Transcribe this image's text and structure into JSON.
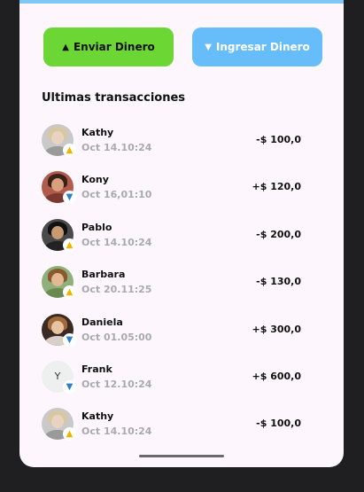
{
  "actions": {
    "send": {
      "label": "Enviar Dinero",
      "glyph": "▲"
    },
    "receive": {
      "label": "Ingresar Dinero",
      "glyph": "▼"
    }
  },
  "section_title": "Ultimas transacciones",
  "transactions": [
    {
      "name": "Kathy",
      "date": "Oct 14.10:24",
      "amount": "-$ 100,0",
      "direction": "up",
      "badge": "▲"
    },
    {
      "name": "Kony",
      "date": "Oct 16,01:10",
      "amount": "+$ 120,0",
      "direction": "down",
      "badge": "▼"
    },
    {
      "name": "Pablo",
      "date": "Oct 14.10:24",
      "amount": "-$ 200,0",
      "direction": "up",
      "badge": "▲"
    },
    {
      "name": "Barbara",
      "date": "Oct 20.11:25",
      "amount": "-$ 130,0",
      "direction": "up",
      "badge": "▲"
    },
    {
      "name": "Daniela",
      "date": "Oct 01.05:00",
      "amount": "+$ 300,0",
      "direction": "down",
      "badge": "▼"
    },
    {
      "name": "Frank",
      "date": "Oct 12.10:24",
      "amount": "+$ 600,0",
      "direction": "down",
      "badge": "▼",
      "initial": "Y"
    },
    {
      "name": "Kathy",
      "date": "Oct 14.10:24",
      "amount": "-$ 100,0",
      "direction": "up",
      "badge": "▲"
    }
  ],
  "colors": {
    "send_button": "#6bd634",
    "receive_button": "#67bdfa",
    "outgoing_badge": "#f0b400",
    "incoming_badge": "#2c7fc5",
    "date_text": "#a9a9b0"
  }
}
